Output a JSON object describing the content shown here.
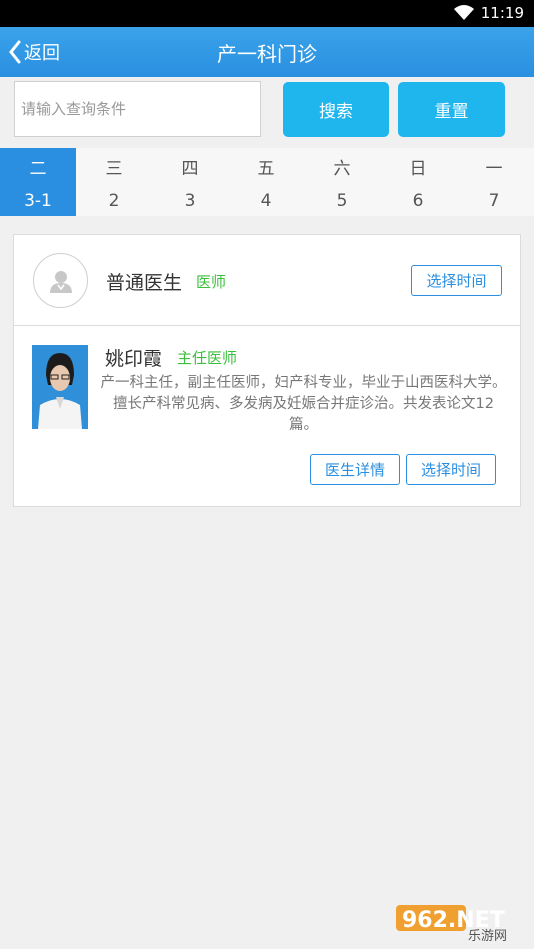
{
  "status_bar": {
    "time": "11:19"
  },
  "header": {
    "back_label": "返回",
    "title": "产一科门诊"
  },
  "search": {
    "placeholder": "请输入查询条件",
    "value": "",
    "search_label": "搜索",
    "reset_label": "重置"
  },
  "days": [
    {
      "name": "二",
      "date": "3-1",
      "active": true
    },
    {
      "name": "三",
      "date": "2",
      "active": false
    },
    {
      "name": "四",
      "date": "3",
      "active": false
    },
    {
      "name": "五",
      "date": "4",
      "active": false
    },
    {
      "name": "六",
      "date": "5",
      "active": false
    },
    {
      "name": "日",
      "date": "6",
      "active": false
    },
    {
      "name": "一",
      "date": "7",
      "active": false
    }
  ],
  "doctors": [
    {
      "name": "普通医生",
      "title": "医师",
      "select_time_label": "选择时间"
    },
    {
      "name": "姚印霞",
      "title": "主任医师",
      "bio": "产一科主任，副主任医师，妇产科专业，毕业于山西医科大学。擅长产科常见病、多发病及妊娠合并症诊治。共发表论文12篇。",
      "detail_label": "医生详情",
      "select_time_label": "选择时间"
    }
  ],
  "watermark": {
    "text_top": "962.NET",
    "text_bottom": "乐游网"
  },
  "colors": {
    "header": "#2a8fe0",
    "button": "#1fb6ee",
    "role_green": "#3cbf3c"
  }
}
